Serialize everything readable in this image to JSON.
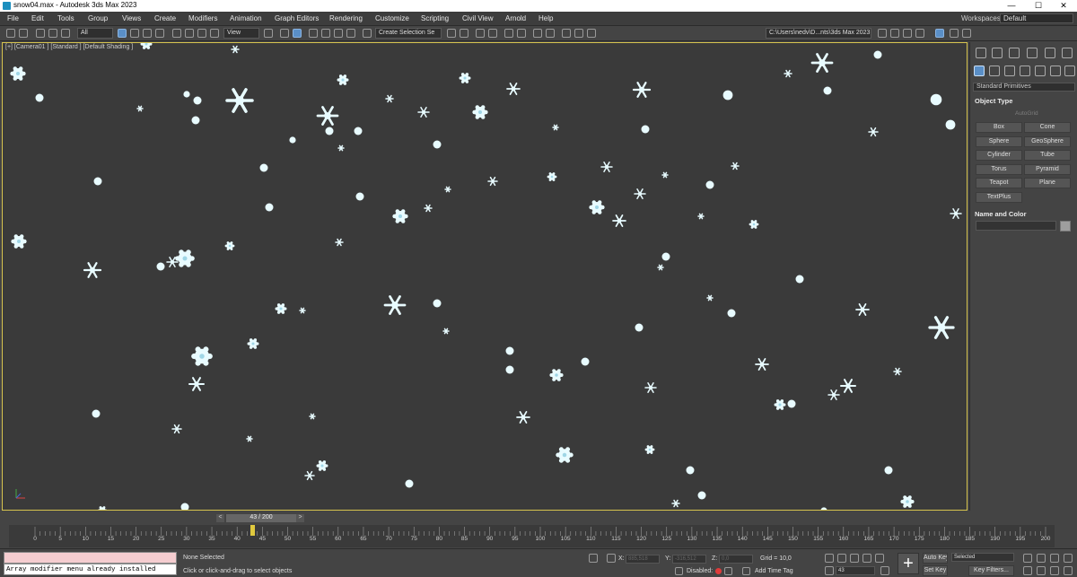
{
  "titlebar": {
    "title": "snow04.max - Autodesk 3ds Max 2023",
    "minimize": "—",
    "maximize": "☐",
    "close": "✕"
  },
  "menus": [
    "File",
    "Edit",
    "Tools",
    "Group",
    "Views",
    "Create",
    "Modifiers",
    "Animation",
    "Graph Editors",
    "Rendering",
    "Customize",
    "Scripting",
    "Civil View",
    "Arnold",
    "Help"
  ],
  "workspace": {
    "label": "Workspaces:",
    "value": "Default"
  },
  "toolbar": {
    "filter_value": "All",
    "reference_coord": "View",
    "selection_set": "Create Selection Se",
    "project_path": "C:\\Users\\nedv\\D...nts\\3ds Max 2023"
  },
  "viewport": {
    "label": "[+] [Camera01 ] [Standard ] [Default Shading ]",
    "background_color": "#3a3a3a",
    "flake_color": "#e8fbff",
    "border_color": "#d6c34e"
  },
  "command_panel": {
    "category_dropdown": "Standard Primitives",
    "object_type_title": "Object Type",
    "autogrid": "AutoGrid",
    "primitives": [
      "Box",
      "Cone",
      "Sphere",
      "GeoSphere",
      "Cylinder",
      "Tube",
      "Torus",
      "Pyramid",
      "Teapot",
      "Plane",
      "TextPlus"
    ],
    "name_color_title": "Name and Color"
  },
  "timeline": {
    "frame_display": "43 / 200",
    "current_frame": 43,
    "total_frames": 200,
    "ticks": [
      "0",
      "5",
      "10",
      "15",
      "20",
      "25",
      "30",
      "35",
      "40",
      "45",
      "50",
      "55",
      "60",
      "65",
      "70",
      "75",
      "80",
      "85",
      "90",
      "95",
      "100",
      "105",
      "110",
      "115",
      "120",
      "125",
      "130",
      "135",
      "140",
      "145",
      "150",
      "155",
      "160",
      "165",
      "170",
      "175",
      "180",
      "185",
      "190",
      "195",
      "200"
    ]
  },
  "status": {
    "maxscript_output": "Array modifier menu already installed",
    "selection": "None Selected",
    "prompt": "Click or click-and-drag to select objects",
    "x_label": "X:",
    "x_value": "885,518",
    "y_label": "Y:",
    "y_value": "-316,512",
    "z_label": "Z:",
    "z_value": "0,0",
    "grid": "Grid = 10,0",
    "disabled_label": "Disabled:",
    "add_time_tag": "Add Time Tag",
    "auto_key": "Auto Key",
    "set_key": "Set Key",
    "key_mode": "Selected",
    "key_filters": "Key Filters...",
    "frame_spinner": "43"
  }
}
